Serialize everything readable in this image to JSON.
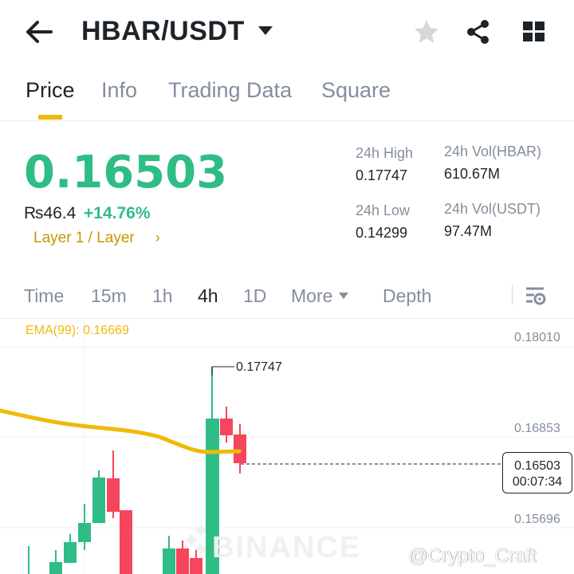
{
  "header": {
    "pair": "HBAR/USDT",
    "icons": {
      "back": "arrow-left-icon",
      "dropdown": "caret-down-icon",
      "favorite": "star-icon",
      "share": "share-icon",
      "more": "grid-icon"
    }
  },
  "tabs": [
    {
      "label": "Price",
      "active": true
    },
    {
      "label": "Info",
      "active": false
    },
    {
      "label": "Trading Data",
      "active": false
    },
    {
      "label": "Square",
      "active": false
    }
  ],
  "ticker": {
    "last_price": "0.16503",
    "fiat_price": "₨46.4",
    "change_pct": "+14.76%",
    "category": "Layer 1 / Layer",
    "category_chevron": "›",
    "high_label": "24h High",
    "high_value": "0.17747",
    "low_label": "24h Low",
    "low_value": "0.14299",
    "vol_base_label": "24h Vol(HBAR)",
    "vol_base_value": "610.67M",
    "vol_quote_label": "24h Vol(USDT)",
    "vol_quote_value": "97.47M"
  },
  "intervals": [
    {
      "label": "Time",
      "active": false
    },
    {
      "label": "15m",
      "active": false
    },
    {
      "label": "1h",
      "active": false
    },
    {
      "label": "4h",
      "active": true
    },
    {
      "label": "1D",
      "active": false
    },
    {
      "label": "More",
      "active": false
    },
    {
      "label": "Depth",
      "active": false
    }
  ],
  "chart": {
    "ema_label": "EMA(99): 0.16669",
    "axis_labels": [
      "0.18010",
      "0.16853",
      "0.15696"
    ],
    "high_marker": "0.17747",
    "current_price": "0.16503",
    "countdown": "00:07:34",
    "watermark": "BINANCE",
    "credit": "@Crypto_Craft",
    "colors": {
      "up": "#2ebd85",
      "down": "#f6465d",
      "ema": "#f0b90b",
      "accent": "#f0b90b"
    }
  }
}
